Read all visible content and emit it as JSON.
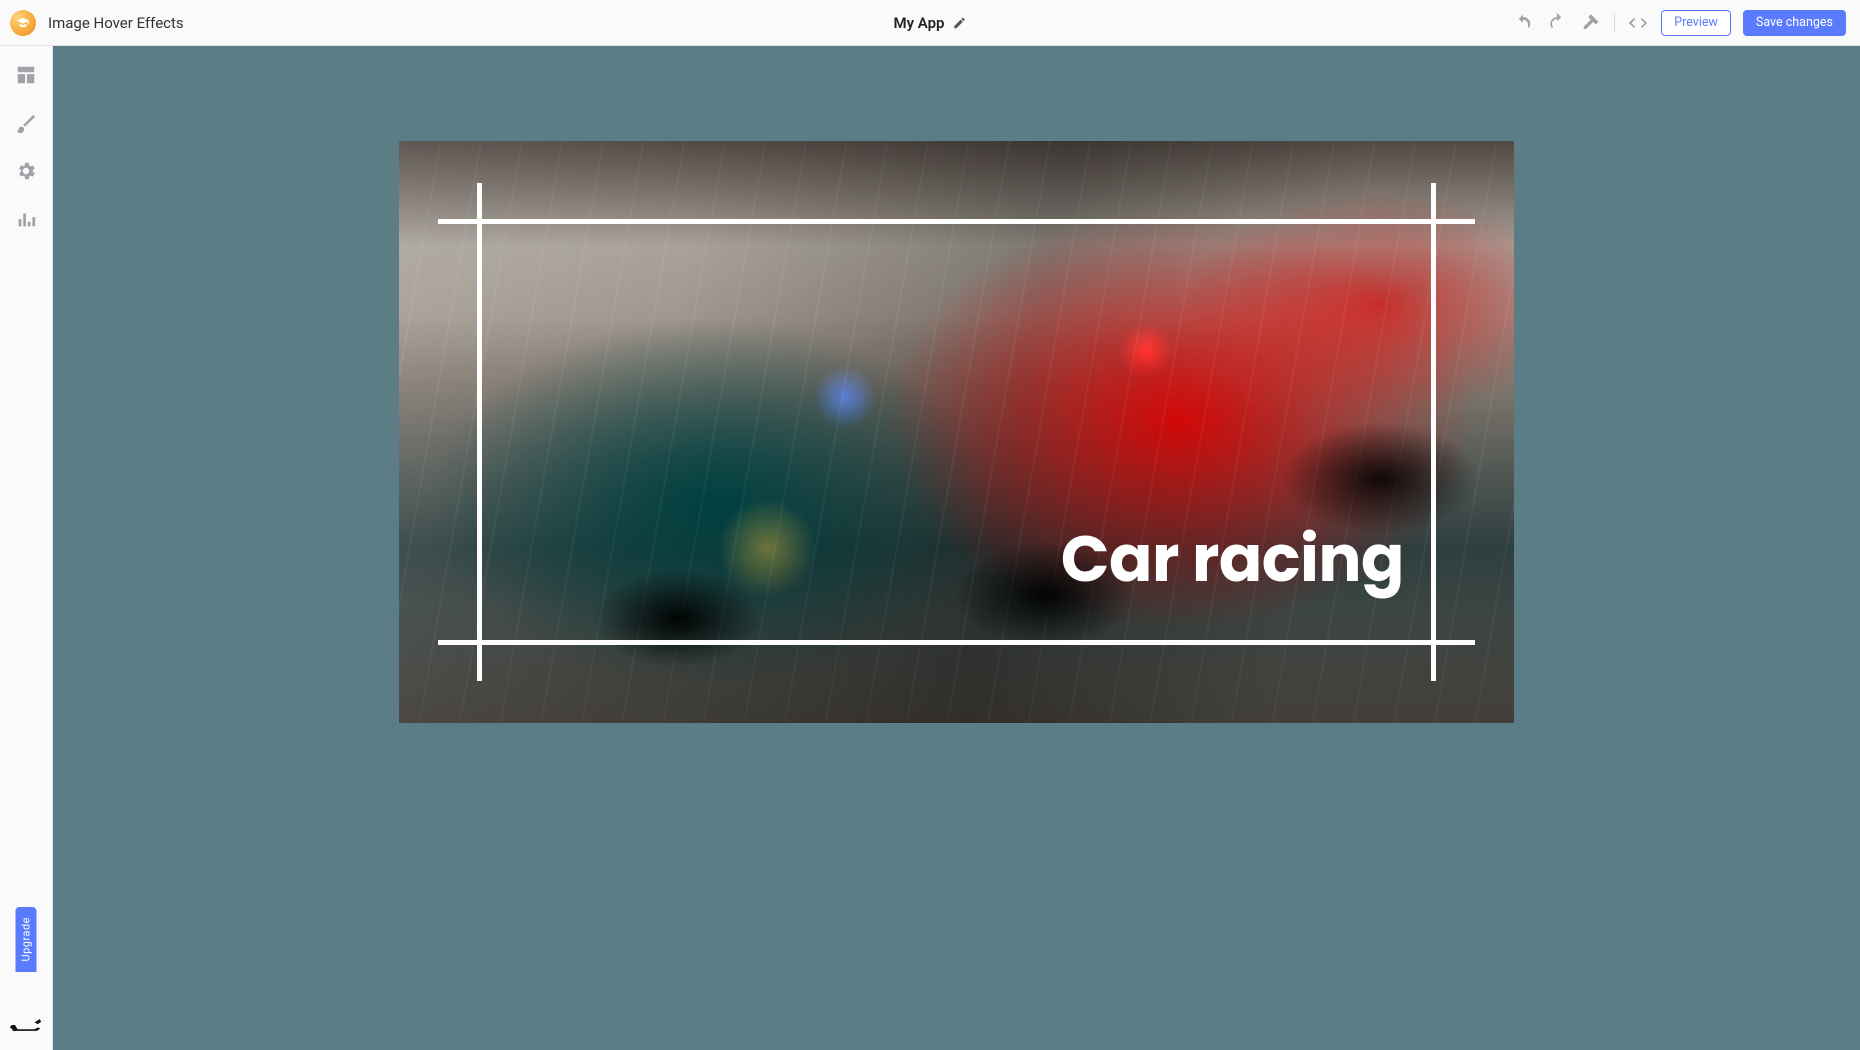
{
  "header": {
    "breadcrumb": "Image Hover Effects",
    "app_name": "My App",
    "brand_icon": "hat-icon",
    "edit_icon": "pencil-icon",
    "actions": {
      "undo_icon": "undo-icon",
      "redo_icon": "redo-icon",
      "hammer_icon": "build-icon",
      "code_icon": "code-icon",
      "preview_label": "Preview",
      "save_label": "Save changes"
    }
  },
  "sidebar": {
    "items": [
      {
        "name": "layout-icon"
      },
      {
        "name": "brush-icon"
      },
      {
        "name": "gear-icon"
      },
      {
        "name": "chart-icon"
      }
    ],
    "upgrade_label": "Upgrade",
    "mascot_icon": "dog-icon"
  },
  "canvas": {
    "background_color": "#5b7d85",
    "card": {
      "image_subject": "formula-1 race cars",
      "overlay_caption": "Car racing",
      "frame_color": "#ffffff"
    }
  },
  "colors": {
    "accent": "#5b7bff",
    "muted_icon": "#9fa2a6"
  }
}
